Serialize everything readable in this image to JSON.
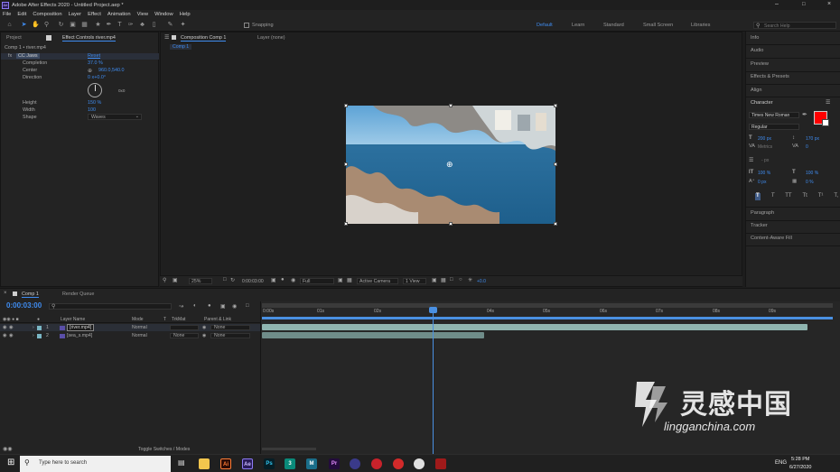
{
  "title_bar": {
    "text": "Adobe After Effects 2020 - Untitled Project.aep *"
  },
  "menu": [
    "File",
    "Edit",
    "Composition",
    "Layer",
    "Effect",
    "Animation",
    "View",
    "Window",
    "Help"
  ],
  "toolbar": {
    "snapping_label": "Snapping",
    "workspaces": [
      "Default",
      "Learn",
      "Standard",
      "Small Screen",
      "Libraries"
    ],
    "active_workspace": "Default",
    "search_placeholder": "Search Help"
  },
  "project_panel": {
    "tab_project": "Project",
    "tab_effect_controls": "Effect Controls river.mp4",
    "breadcrumb": "Comp 1 • river.mp4",
    "effect_name": "CC Jaws",
    "reset_label": "Reset",
    "props": [
      {
        "name": "Completion",
        "value": "37.0 %"
      },
      {
        "name": "Center",
        "value": "960.0,540.0"
      },
      {
        "name": "Direction",
        "value": "0 x+0.0°"
      },
      {
        "name": "Height",
        "value": "150 %"
      },
      {
        "name": "Width",
        "value": "100"
      },
      {
        "name": "Shape",
        "value": "Waves"
      }
    ],
    "dial_label": "0x0"
  },
  "comp_panel": {
    "tab_label": "Composition Comp 1",
    "tab_layer": "Layer (none)",
    "subtab": "Comp 1",
    "zoom": "25%",
    "timecode": "0:00:03:00",
    "resolution": "Full",
    "camera": "Active Camera",
    "views": "1 View",
    "exposure": "+0.0"
  },
  "right_panel": {
    "sections_top": [
      "Info",
      "Audio",
      "Preview",
      "Effects & Presets",
      "Align"
    ],
    "character_title": "Character",
    "font": "Times New Roman",
    "style": "Regular",
    "font_size": "200 px",
    "leading": "170 px",
    "kerning": "Metrics",
    "tracking": "0",
    "stroke_width": "- px",
    "vscale": "100 %",
    "hscale": "100 %",
    "baseline": "0 px",
    "tsume": "0 %",
    "text_color": "#ff0000",
    "format_buttons": [
      "T",
      "T",
      "TT",
      "Tt",
      "T¹",
      "T,"
    ],
    "sections_bottom": [
      "Paragraph",
      "Tracker",
      "Content-Aware Fill"
    ]
  },
  "timeline": {
    "tab_comp": "Comp 1",
    "tab_render": "Render Queue",
    "current_time": "0:00:03:00",
    "columns": {
      "layer_name": "Layer Name",
      "mode": "Mode",
      "track": "T",
      "trkmat": "TrkMat",
      "parent": "Parent & Link"
    },
    "layers": [
      {
        "num": "1",
        "name": "[river.mp4]",
        "mode": "Normal",
        "trkmat": "",
        "parent": "None",
        "selected": true
      },
      {
        "num": "2",
        "name": "[sea_s.mp4]",
        "mode": "Normal",
        "trkmat": "None",
        "parent": "None",
        "selected": false
      }
    ],
    "ruler": [
      "0:00s",
      "01s",
      "02s",
      "03s",
      "04s",
      "05s",
      "06s",
      "07s",
      "08s",
      "09s"
    ],
    "toggle_label": "Toggle Switches / Modes"
  },
  "taskbar": {
    "search_placeholder": "Type here to search",
    "time": "5:28 PM",
    "date": "6/27/2020",
    "lang": "ENG"
  },
  "watermark": {
    "cn_text": "灵感中国",
    "url": "lingganchina.com"
  }
}
